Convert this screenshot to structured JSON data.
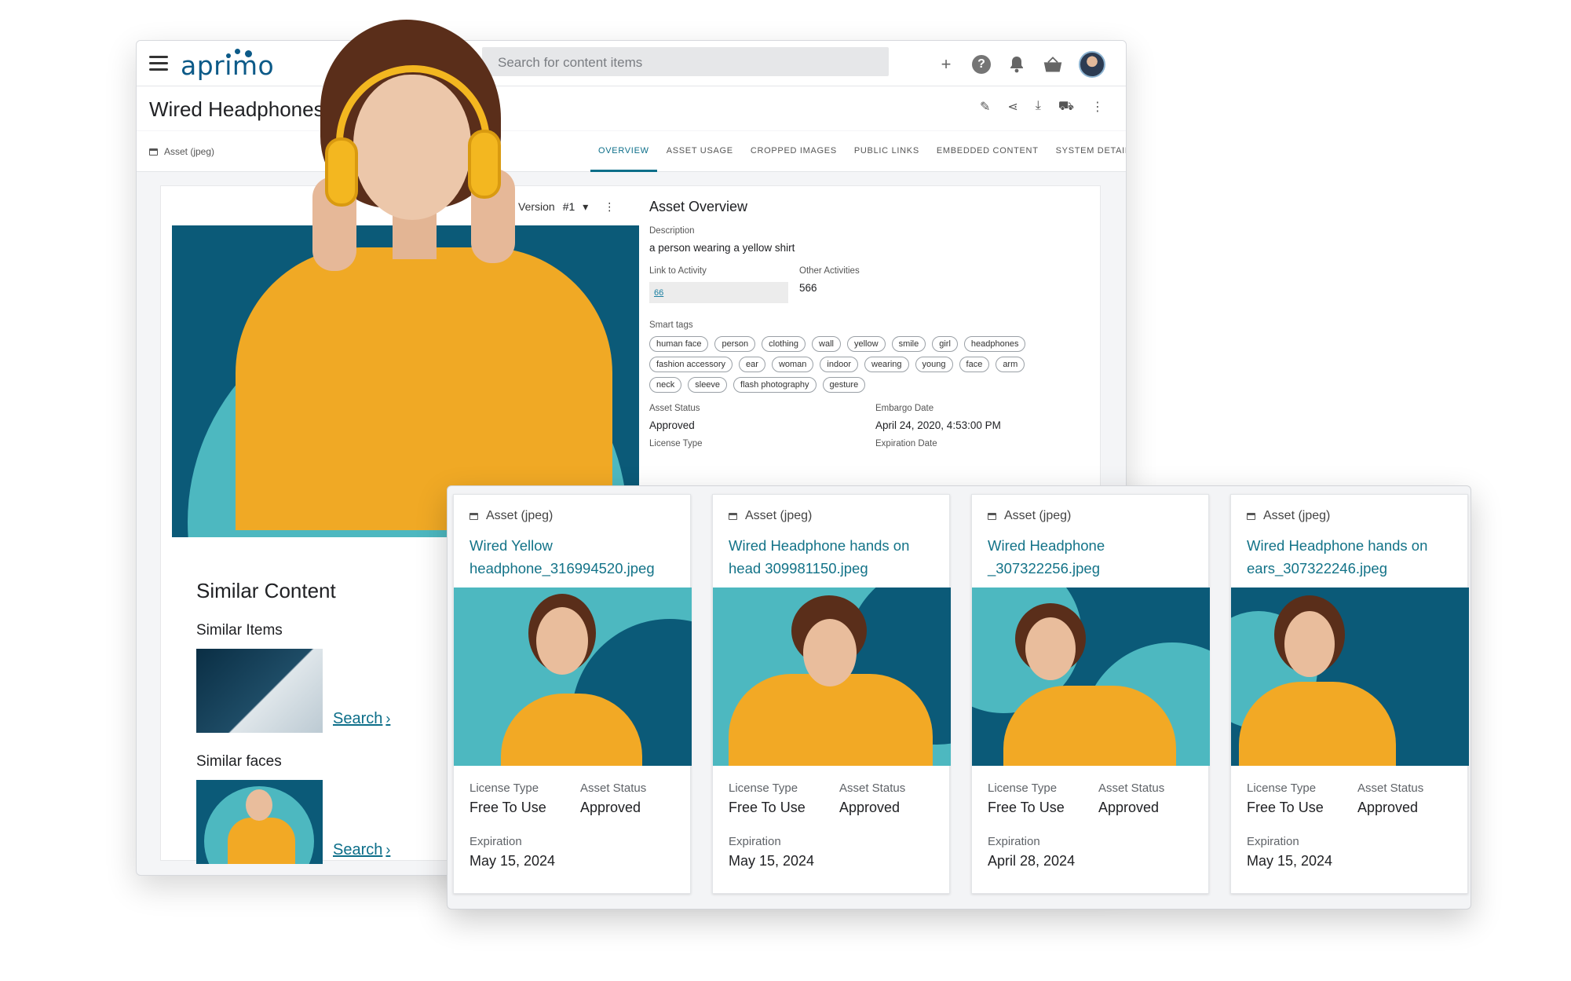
{
  "app": {
    "logo_text": "aprimo",
    "search_placeholder": "Search for content items"
  },
  "asset": {
    "title": "Wired Headphones",
    "type_label": "Asset (jpeg)",
    "version_label": "Version",
    "version_value": "#1"
  },
  "tabs": [
    "OVERVIEW",
    "ASSET USAGE",
    "CROPPED IMAGES",
    "PUBLIC LINKS",
    "EMBEDDED CONTENT",
    "SYSTEM DETAILS"
  ],
  "overview": {
    "title": "Asset Overview",
    "description_label": "Description",
    "description": "a person wearing a yellow shirt",
    "link_label": "Link to Activity",
    "link_value": "66",
    "other_label": "Other Activities",
    "other_value": "566",
    "tags_label": "Smart tags",
    "tags": [
      "human face",
      "person",
      "clothing",
      "wall",
      "yellow",
      "smile",
      "girl",
      "headphones",
      "fashion accessory",
      "ear",
      "woman",
      "indoor",
      "wearing",
      "young",
      "face",
      "arm",
      "neck",
      "sleeve",
      "flash photography",
      "gesture"
    ],
    "status_label": "Asset Status",
    "status_value": "Approved",
    "embargo_label": "Embargo Date",
    "embargo_value": "April 24, 2020, 4:53:00 PM",
    "license_label": "License Type",
    "expiration_label": "Expiration Date"
  },
  "similar": {
    "heading": "Similar Content",
    "items_label": "Similar Items",
    "faces_label": "Similar faces",
    "search_label": "Search"
  },
  "cards": [
    {
      "type": "Asset (jpeg)",
      "title": "Wired Yellow headphone_316994520.jpeg",
      "license_label": "License Type",
      "license": "Free To Use",
      "status_label": "Asset Status",
      "status": "Approved",
      "exp_label": "Expiration",
      "exp": "May 15, 2024"
    },
    {
      "type": "Asset (jpeg)",
      "title": "Wired Headphone hands on head 309981150.jpeg",
      "license_label": "License Type",
      "license": "Free To Use",
      "status_label": "Asset Status",
      "status": "Approved",
      "exp_label": "Expiration",
      "exp": "May 15, 2024"
    },
    {
      "type": "Asset (jpeg)",
      "title": "Wired Headphone _307322256.jpeg",
      "license_label": "License Type",
      "license": "Free To Use",
      "status_label": "Asset Status",
      "status": "Approved",
      "exp_label": "Expiration",
      "exp": "April 28, 2024"
    },
    {
      "type": "Asset (jpeg)",
      "title": "Wired Headphone hands on ears_307322246.jpeg",
      "license_label": "License Type",
      "license": "Free To Use",
      "status_label": "Asset Status",
      "status": "Approved",
      "exp_label": "Expiration",
      "exp": "May 15, 2024"
    }
  ],
  "colors": {
    "brand": "#0c5a88",
    "accent": "#137388",
    "teal": "#4db8c0",
    "navy": "#0b5a78",
    "yellow": "#f2a925"
  },
  "icons": [
    "menu-icon",
    "plus-icon",
    "help-icon",
    "bell-icon",
    "basket-icon",
    "edit-icon",
    "share-icon",
    "download-icon",
    "add-to-basket-icon",
    "more-icon"
  ]
}
